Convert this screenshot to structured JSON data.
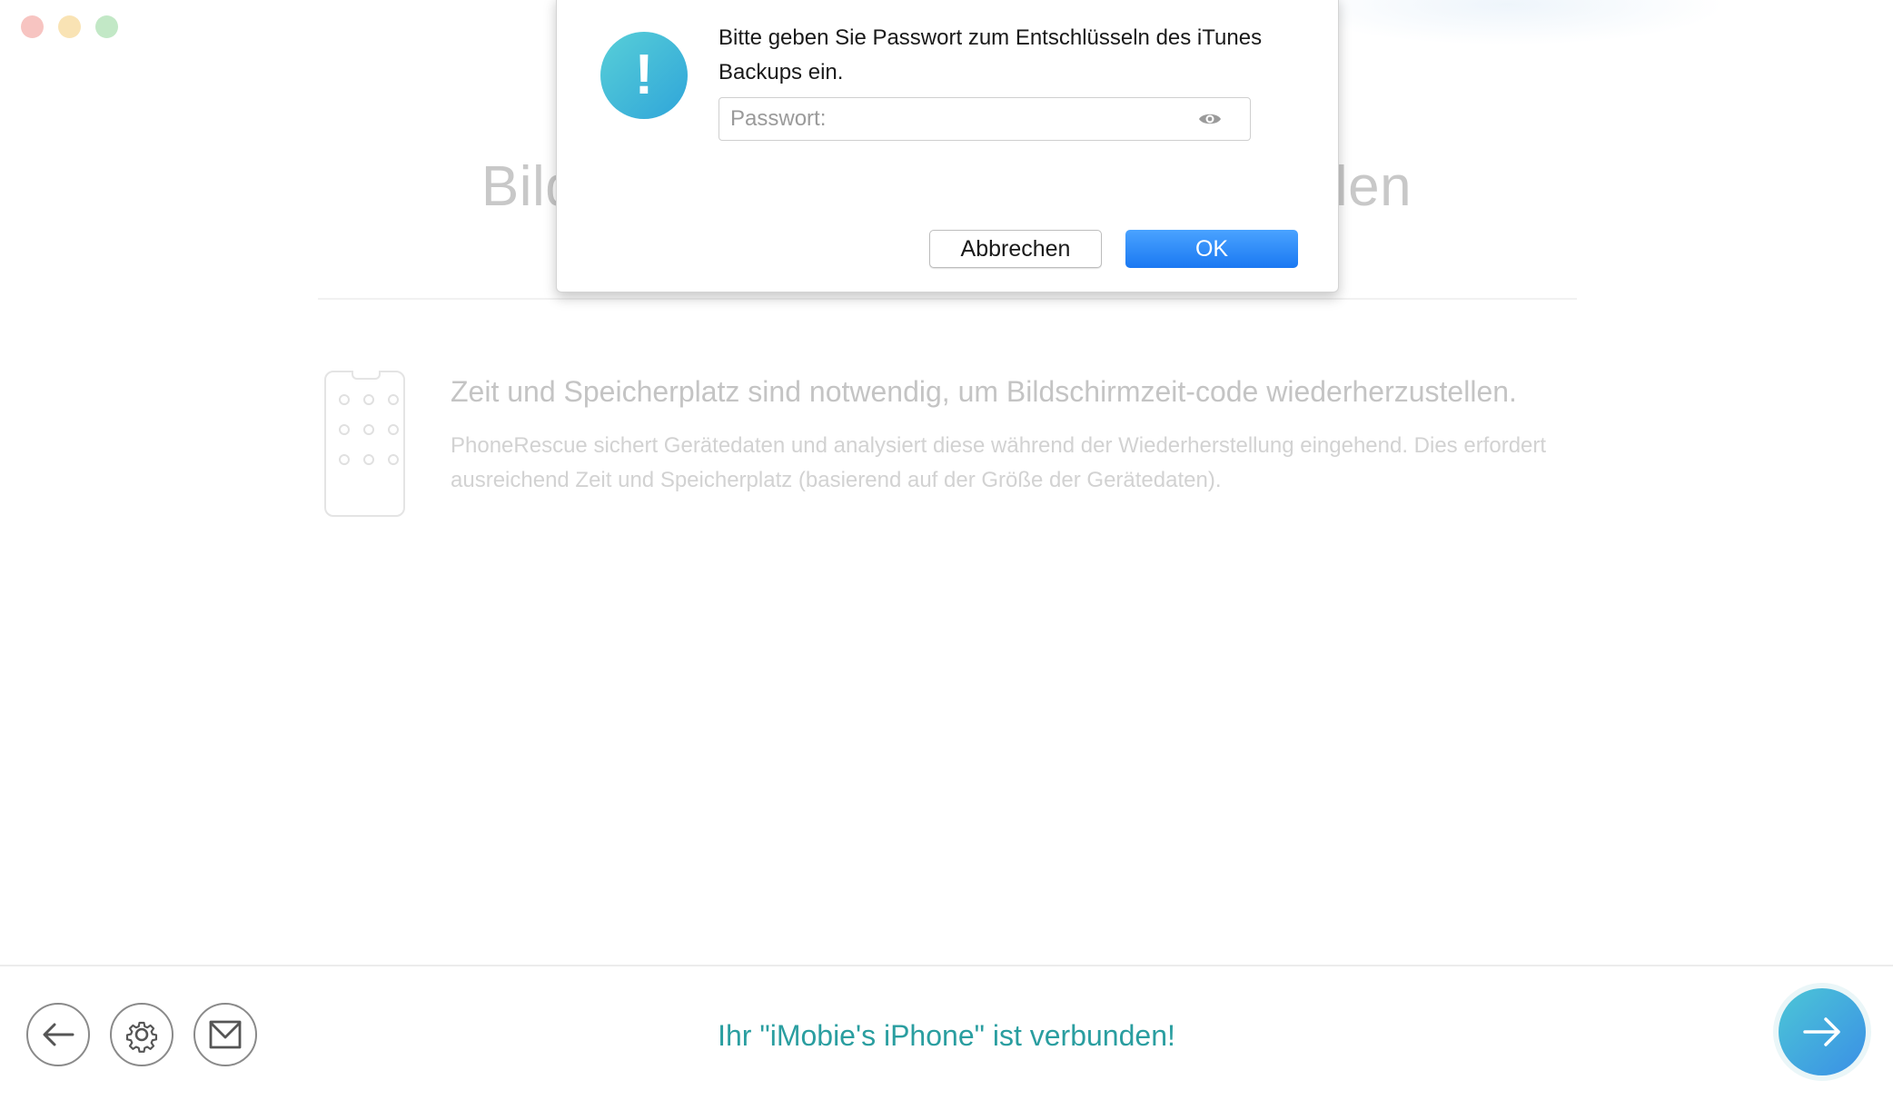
{
  "background": {
    "title": "Bildschirmzeit-code wiederherstellen",
    "info_title": "Zeit und Speicherplatz sind notwendig, um Bildschirmzeit-code wiederherzustellen.",
    "info_description": "PhoneRescue sichert Gerätedaten und analysiert diese während der Wiederherstellung eingehend. Dies erfordert ausreichend Zeit und Speicherplatz (basierend auf der Größe der Gerätedaten)."
  },
  "dialog": {
    "message": "Bitte geben Sie Passwort zum Entschlüsseln des iTunes Backups ein.",
    "password_placeholder": "Passwort:",
    "password_value": "",
    "cancel_label": "Abbrechen",
    "ok_label": "OK"
  },
  "footer": {
    "status": "Ihr \"iMobie's iPhone\" ist verbunden!"
  },
  "icons": {
    "alert": "exclamation-icon",
    "password_visibility": "eye-icon",
    "back": "arrow-left-icon",
    "settings": "gear-icon",
    "mail": "mail-icon",
    "next": "arrow-right-icon"
  },
  "colors": {
    "accent": "#1a78f2",
    "status_text": "#2a9ea0",
    "alert_icon": "#2fa5d9"
  }
}
